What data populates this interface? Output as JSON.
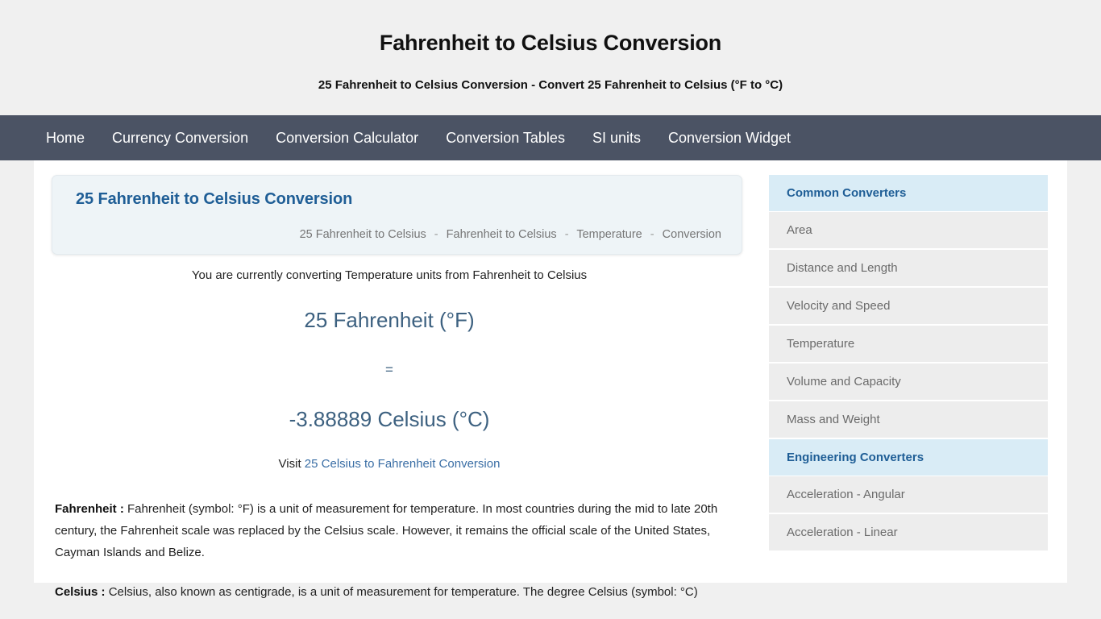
{
  "header": {
    "title": "Fahrenheit to Celsius Conversion",
    "subtitle": "25 Fahrenheit to Celsius Conversion - Convert 25 Fahrenheit to Celsius (°F to °C)"
  },
  "nav": {
    "items": [
      {
        "label": "Home"
      },
      {
        "label": "Currency Conversion"
      },
      {
        "label": "Conversion Calculator"
      },
      {
        "label": "Conversion Tables"
      },
      {
        "label": "SI units"
      },
      {
        "label": "Conversion Widget"
      }
    ]
  },
  "card": {
    "title": "25 Fahrenheit to Celsius Conversion",
    "breadcrumb": [
      "25 Fahrenheit to Celsius",
      "Fahrenheit to Celsius",
      "Temperature",
      "Conversion"
    ],
    "separator": "-"
  },
  "conversion": {
    "intro": "You are currently converting Temperature units from Fahrenheit to Celsius",
    "from_value": "25 Fahrenheit (°F)",
    "equals": "=",
    "to_value": "-3.88889 Celsius (°C)",
    "visit_prefix": "Visit",
    "visit_link": "25 Celsius to Fahrenheit Conversion"
  },
  "definitions": [
    {
      "term": "Fahrenheit :",
      "text": " Fahrenheit (symbol: °F) is a unit of measurement for temperature. In most countries during the mid to late 20th century, the Fahrenheit scale was replaced by the Celsius scale. However, it remains the official scale of the United States, Cayman Islands and Belize."
    },
    {
      "term": "Celsius :",
      "text": " Celsius, also known as centigrade, is a unit of measurement for temperature. The degree Celsius (symbol: °C)"
    }
  ],
  "sidebar": {
    "sections": [
      {
        "header": "Common Converters",
        "items": [
          {
            "label": "Area"
          },
          {
            "label": "Distance and Length"
          },
          {
            "label": "Velocity and Speed"
          },
          {
            "label": "Temperature"
          },
          {
            "label": "Volume and Capacity"
          },
          {
            "label": "Mass and Weight"
          }
        ]
      },
      {
        "header": "Engineering Converters",
        "items": [
          {
            "label": "Acceleration - Angular"
          },
          {
            "label": "Acceleration - Linear"
          }
        ]
      }
    ]
  },
  "colors": {
    "nav_background": "#4b5364",
    "accent_blue": "#1f5e96",
    "conversion_text": "#3d6180",
    "sidebar_header_bg": "#d9ecf6",
    "sidebar_item_bg": "#ededed",
    "page_background": "#f0f0f0",
    "card_background": "#eef4f7"
  }
}
